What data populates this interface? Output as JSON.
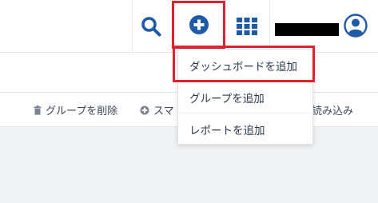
{
  "header": {
    "icons": {
      "search": "search-icon",
      "add": "plus-circle-icon",
      "apps": "grid-icon",
      "account": "user-circle-icon"
    },
    "username_redacted": true
  },
  "toolbar": {
    "delete_group_label": "グループを削除",
    "smart_label": "スマ",
    "import_label": "読み込み"
  },
  "add_menu": {
    "items": [
      {
        "label": "ダッシュボードを追加",
        "highlighted": true
      },
      {
        "label": "グループを追加"
      },
      {
        "label": "レポートを追加"
      }
    ]
  },
  "colors": {
    "accent": "#1f5aa8",
    "highlight_border": "#e2202e"
  }
}
